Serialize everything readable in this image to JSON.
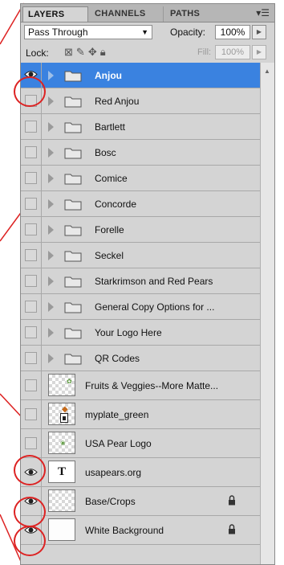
{
  "tabs": [
    {
      "label": "LAYERS",
      "active": true
    },
    {
      "label": "CHANNELS",
      "active": false
    },
    {
      "label": "PATHS",
      "active": false
    }
  ],
  "panel_menu_icon": "panel-menu-icon",
  "blend": {
    "mode": "Pass Through"
  },
  "opacity": {
    "label": "Opacity:",
    "value": "100%"
  },
  "lock": {
    "label": "Lock:",
    "icons": [
      "lock-transparent-icon",
      "lock-image-icon",
      "lock-position-icon",
      "lock-all-icon"
    ]
  },
  "fill": {
    "label": "Fill:",
    "value": "100%"
  },
  "layers": [
    {
      "name": "Anjou",
      "type": "group",
      "visible": true,
      "selected": true
    },
    {
      "name": "Red Anjou",
      "type": "group",
      "visible": false
    },
    {
      "name": "Bartlett",
      "type": "group",
      "visible": false
    },
    {
      "name": "Bosc",
      "type": "group",
      "visible": false
    },
    {
      "name": "Comice",
      "type": "group",
      "visible": false
    },
    {
      "name": "Concorde",
      "type": "group",
      "visible": false
    },
    {
      "name": "Forelle",
      "type": "group",
      "visible": false
    },
    {
      "name": "Seckel",
      "type": "group",
      "visible": false
    },
    {
      "name": "Starkrimson and Red Pears",
      "type": "group",
      "visible": false
    },
    {
      "name": "General Copy Options for ...",
      "type": "group",
      "visible": false
    },
    {
      "name": "Your Logo Here",
      "type": "group",
      "visible": false
    },
    {
      "name": "QR Codes",
      "type": "group",
      "visible": false
    },
    {
      "name": "Fruits & Veggies--More Matte...",
      "type": "layer",
      "visible": false
    },
    {
      "name": "myplate_green",
      "type": "smart",
      "visible": false
    },
    {
      "name": "USA Pear Logo",
      "type": "layer",
      "visible": false
    },
    {
      "name": "usapears.org",
      "type": "text",
      "visible": true
    },
    {
      "name": "Base/Crops",
      "type": "layer",
      "visible": true,
      "locked": true
    },
    {
      "name": "White Background",
      "type": "layer",
      "visible": true,
      "locked": true
    }
  ],
  "colors": {
    "selection": "#3a82e0",
    "annotation": "#d22222"
  }
}
